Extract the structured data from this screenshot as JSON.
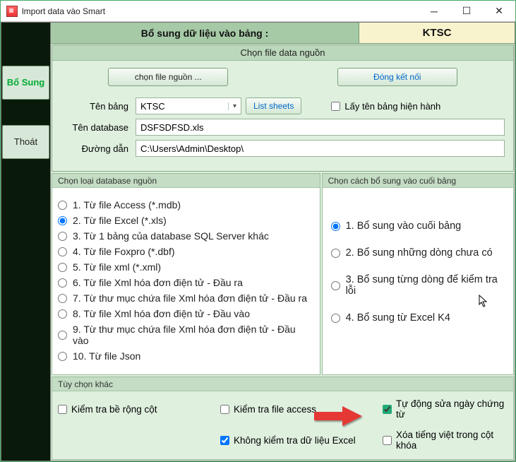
{
  "window": {
    "title": "lmport data vào Smart"
  },
  "header": {
    "left": "Bổ sung dữ liệu vào bảng :",
    "right": "KTSC"
  },
  "sidebar": {
    "btn1": "Bổ Sung",
    "btn2": "Thoát"
  },
  "sourcePanel": {
    "title": "Chọn file data nguồn",
    "btnChoose": "chọn file nguồn ...",
    "btnClose": "Đóng kết nối",
    "lblTable": "Tên bảng",
    "tableValue": "KTSC",
    "btnListSheets": "List sheets",
    "chkCurrentTable": "Lấy tên bảng hiện hành",
    "lblDatabase": "Tên database",
    "dbValue": "DSFSDFSD.xls",
    "lblPath": "Đường dẫn",
    "pathValue": "C:\\Users\\Admin\\Desktop\\"
  },
  "leftGroup": {
    "title": "Chọn loại database nguồn",
    "items": [
      "1. Từ file Access (*.mdb)",
      "2. Từ file Excel (*.xls)",
      "3. Từ 1 bảng của database SQL Server khác",
      "4. Từ file Foxpro (*.dbf)",
      "5. Từ file xml (*.xml)",
      "6. Từ file Xml hóa đơn điện tử - Đầu ra",
      "7. Từ thư mục chứa file Xml hóa đơn điện tử - Đầu ra",
      "8. Từ file Xml hóa đơn điện tử - Đầu vào",
      "9. Từ thư mục chứa file Xml hóa đơn điện tử - Đầu vào",
      "10. Từ file Json"
    ],
    "selected": 1
  },
  "rightGroup": {
    "title": "Chọn cách bổ sung vào cuối bảng",
    "items": [
      "1. Bổ sung vào cuối bảng",
      "2. Bổ sung những dòng chưa có",
      "3. Bổ sung từng dòng để kiểm tra lỗi",
      "4. Bổ sung từ Excel K4"
    ],
    "selected": 0
  },
  "otherGroup": {
    "title": "Tùy chọn khác",
    "chkWidth": "Kiểm tra bề rộng cột",
    "chkAccess": "Kiểm tra file access",
    "chkAutoDate": "Tự động sửa ngày chứng từ",
    "chkNoExcel": "Không kiểm tra dữ liệu Excel",
    "chkRemoveVN": "Xóa tiếng việt trong cột khóa"
  }
}
